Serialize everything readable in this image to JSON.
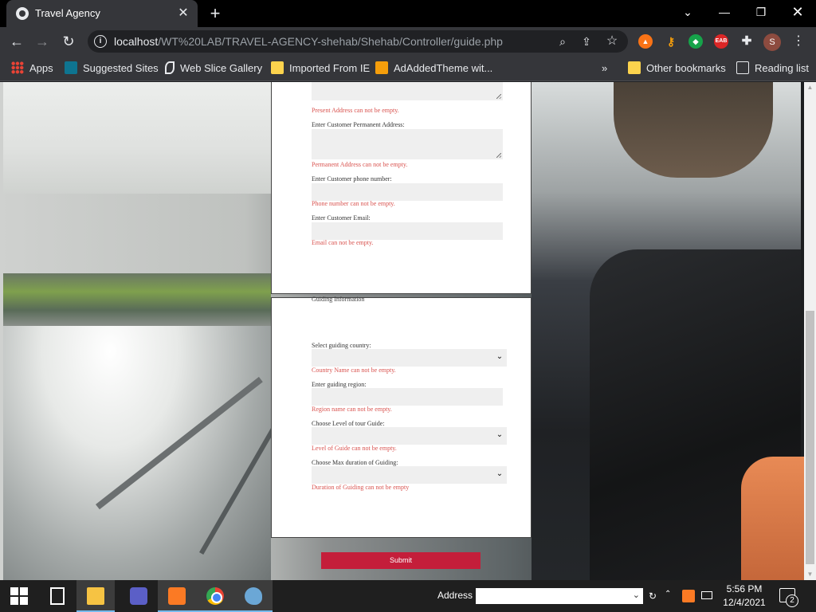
{
  "browser": {
    "tab_title": "Travel Agency",
    "tab_close": "✕",
    "new_tab": "+",
    "window_controls": {
      "tab_search": "⌄",
      "minimize": "—",
      "maximize": "❐",
      "close": "✕"
    },
    "nav": {
      "back": "←",
      "forward": "→",
      "reload": "↻"
    },
    "url_host": "localhost",
    "url_path": "/WT%20LAB/TRAVEL-AGENCY-shehab/Shehab/Controller/guide.php",
    "profile_initial": "S",
    "ext4_label": "EAB",
    "menu": "⋮"
  },
  "bookmarks": {
    "apps": "Apps",
    "suggested": "Suggested Sites",
    "webslice": "Web Slice Gallery",
    "ie": "Imported From IE",
    "theme": "AdAddedTheme wit...",
    "overflow": "»",
    "other": "Other bookmarks",
    "reading": "Reading list"
  },
  "customer_section": {
    "present_address_error": "Present Address can not be empty.",
    "permanent_address_label": "Enter Customer Permanent Address:",
    "permanent_address_error": "Permanent Address can not be empty.",
    "phone_label": "Enter Customer phone number:",
    "phone_error": "Phone number can not be empty.",
    "email_label": "Enter Customer Email:",
    "email_error": "Email can not be empty."
  },
  "guiding_section": {
    "title": "Guiding Information",
    "country_label": "Select guiding country:",
    "country_error": "Country Name can not be empty.",
    "region_label": "Enter guiding region:",
    "region_error": "Region name can not be empty.",
    "level_label": "Choose Level of tour Guide:",
    "level_error": "Level of Guide can not be empty.",
    "duration_label": "Choose Max duration of Guiding:",
    "duration_error": "Duration of Guiding can not be empty",
    "chevron": "⌄"
  },
  "submit_label": "Submit",
  "scrollbar": {
    "up": "▲",
    "down": "▼"
  },
  "taskbar": {
    "address_label": "Address",
    "address_dropdown": "⌄",
    "address_go": "↻",
    "tray_up": "⌃",
    "time": "5:56 PM",
    "date": "12/4/2021",
    "notification_count": "2"
  }
}
